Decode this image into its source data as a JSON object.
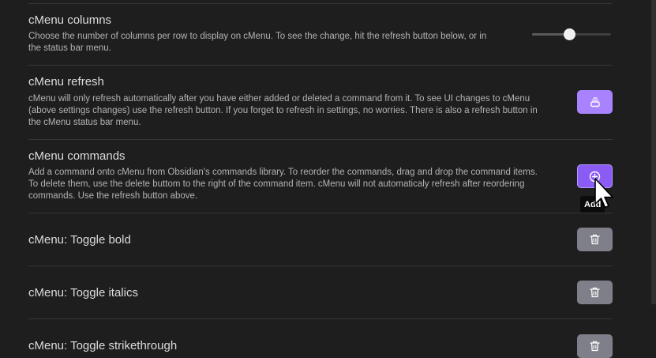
{
  "settings": [
    {
      "title": "cMenu columns",
      "description_lines": [
        "Choose the number of columns per row to display on cMenu. To see the change, hit the refresh button below, or in",
        "the status bar menu."
      ],
      "control": "slider",
      "slider_level_fraction": 0.48
    },
    {
      "title": "cMenu refresh",
      "description_lines": [
        "cMenu will only refresh automatically after you have either added or deleted a command from it. To see UI changes to cMenu",
        "(above settings changes) use the refresh button. If you forget to refresh in settings, no worries. There is also a refresh button in",
        "the cMenu status bar menu."
      ],
      "control": "button",
      "button_icon": "refresh-stack-icon"
    },
    {
      "title": "cMenu commands",
      "description_lines": [
        "Add a command onto cMenu from Obsidian's commands library. To reorder the commands, drag and drop the command items.",
        "To delete them, use the delete buttom to the right of the command item. cMenu will not automaticaly refresh after reordering",
        "commands. Use the refresh button above."
      ],
      "control": "button",
      "button_icon": "add-circle-icon",
      "tooltip": "Add"
    }
  ],
  "commands": [
    {
      "title": "cMenu: Toggle bold",
      "button_icon": "trash-icon"
    },
    {
      "title": "cMenu: Toggle italics",
      "button_icon": "trash-icon"
    },
    {
      "title": "cMenu: Toggle strikethrough",
      "button_icon": "trash-icon"
    }
  ],
  "colors": {
    "background": "#1e1e1e",
    "accent_button": "#a882ff",
    "accent_button_hover": "#8a5cf5",
    "muted_button": "#7f7f89",
    "divider": "#363636"
  }
}
